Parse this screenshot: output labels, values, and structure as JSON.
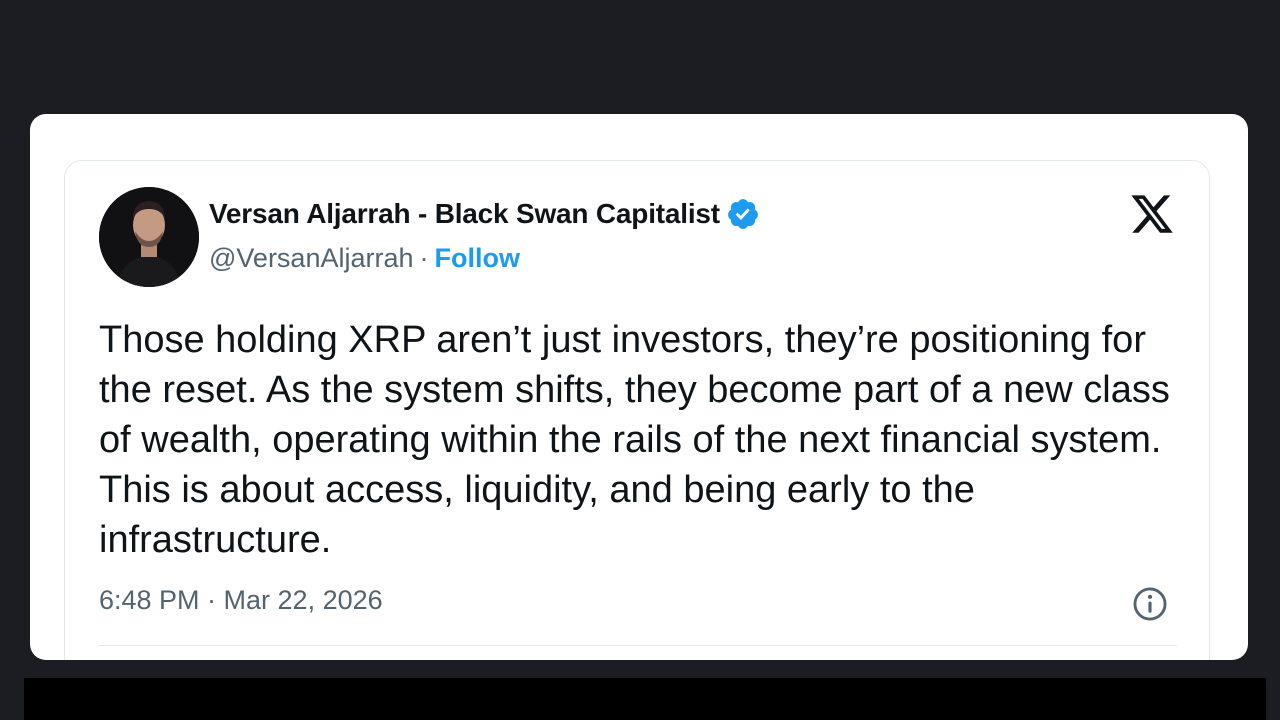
{
  "tweet": {
    "author_name": "Versan Aljarrah - Black Swan Capitalist",
    "handle": "@VersanAljarrah",
    "separator": "·",
    "follow_label": "Follow",
    "text": "Those holding XRP aren’t just investors, they’re positioning for the reset. As the system shifts, they become part of a new class of wealth, operating within the rails of the next financial system. This is about access, liquidity, and being early to the infrastructure.",
    "timestamp": "6:48 PM · Mar 22, 2026",
    "verified_badge_icon": "verified-icon",
    "platform_icon": "x-logo-icon",
    "info_icon": "info-icon"
  },
  "colors": {
    "background": "#1c1d22",
    "card": "#ffffff",
    "text_primary": "#0f1419",
    "text_secondary": "#536471",
    "accent": "#1d9bf0"
  }
}
